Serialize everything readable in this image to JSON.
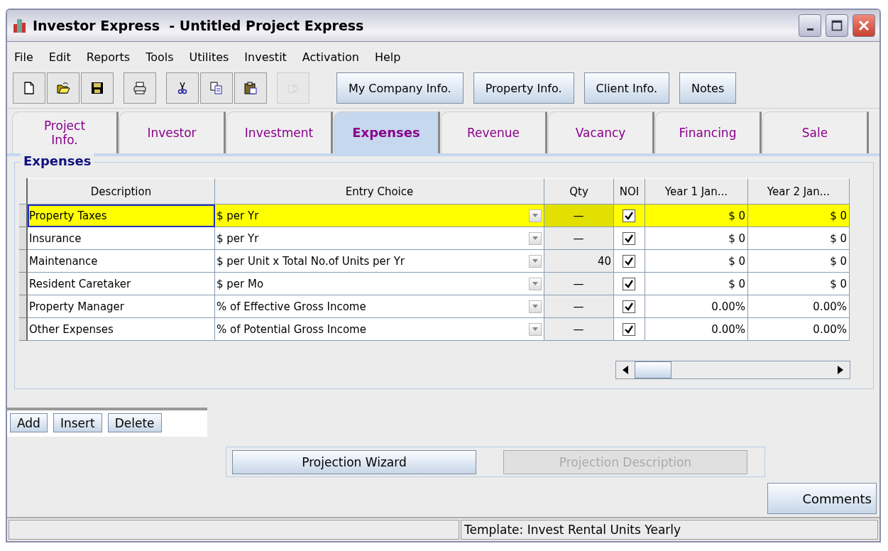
{
  "window": {
    "title": "Investor Express  - Untitled Project Express"
  },
  "menu": [
    {
      "label": "File"
    },
    {
      "label": "Edit"
    },
    {
      "label": "Reports"
    },
    {
      "label": "Tools"
    },
    {
      "label": "Utilites"
    },
    {
      "label": "Investit"
    },
    {
      "label": "Activation"
    },
    {
      "label": "Help"
    }
  ],
  "toolbar": [
    [
      {
        "kind": "new",
        "disabled": false
      },
      {
        "kind": "open",
        "disabled": false
      },
      {
        "kind": "save",
        "disabled": false
      }
    ],
    [
      {
        "kind": "print",
        "disabled": false
      }
    ],
    [
      {
        "kind": "cut",
        "disabled": false
      },
      {
        "kind": "copy",
        "disabled": false
      },
      {
        "kind": "paste",
        "disabled": false
      }
    ],
    [
      {
        "kind": "export",
        "disabled": true
      }
    ]
  ],
  "toolbar_buttons": [
    {
      "label": "My Company Info."
    },
    {
      "label": "Property Info."
    },
    {
      "label": "Client Info."
    },
    {
      "label": "Notes"
    }
  ],
  "tabs": [
    {
      "label": "Project\nInfo.",
      "selected": false
    },
    {
      "label": "Investor",
      "selected": false
    },
    {
      "label": "Investment",
      "selected": false
    },
    {
      "label": "Expenses",
      "selected": true
    },
    {
      "label": "Revenue",
      "selected": false
    },
    {
      "label": "Vacancy",
      "selected": false
    },
    {
      "label": "Financing",
      "selected": false
    },
    {
      "label": "Sale",
      "selected": false
    }
  ],
  "group_title": "Expenses",
  "table": {
    "columns": [
      "Description",
      "Entry Choice",
      "Qty",
      "NOI",
      "Year 1 Jan...",
      "Year 2 Jan..."
    ],
    "rows": [
      {
        "description": "Property Taxes",
        "entry_choice": "$ per Yr",
        "qty": "—",
        "noi": true,
        "year_1": "$ 0",
        "year_2": "$ 0",
        "selected": true
      },
      {
        "description": "Insurance",
        "entry_choice": "$ per Yr",
        "qty": "—",
        "noi": true,
        "year_1": "$ 0",
        "year_2": "$ 0",
        "selected": false
      },
      {
        "description": "Maintenance",
        "entry_choice": "$ per Unit x Total No.of Units per Yr",
        "qty": "40",
        "noi": true,
        "year_1": "$ 0",
        "year_2": "$ 0",
        "selected": false
      },
      {
        "description": "Resident Caretaker",
        "entry_choice": "$ per Mo",
        "qty": "—",
        "noi": true,
        "year_1": "$ 0",
        "year_2": "$ 0",
        "selected": false
      },
      {
        "description": "Property Manager",
        "entry_choice": "% of Effective Gross Income",
        "qty": "—",
        "noi": true,
        "year_1": "0.00%",
        "year_2": "0.00%",
        "selected": false
      },
      {
        "description": "Other Expenses",
        "entry_choice": "% of Potential Gross Income",
        "qty": "—",
        "noi": true,
        "year_1": "0.00%",
        "year_2": "0.00%",
        "selected": false
      }
    ]
  },
  "row_buttons": [
    {
      "label": "Add"
    },
    {
      "label": "Insert"
    },
    {
      "label": "Delete"
    }
  ],
  "projection_buttons": [
    {
      "label": "Projection Wizard",
      "disabled": false
    },
    {
      "label": "Projection Description",
      "disabled": true
    }
  ],
  "comments_button": {
    "label": "Comments"
  },
  "status_bar": {
    "right": "Template: Invest Rental Units Yearly"
  }
}
